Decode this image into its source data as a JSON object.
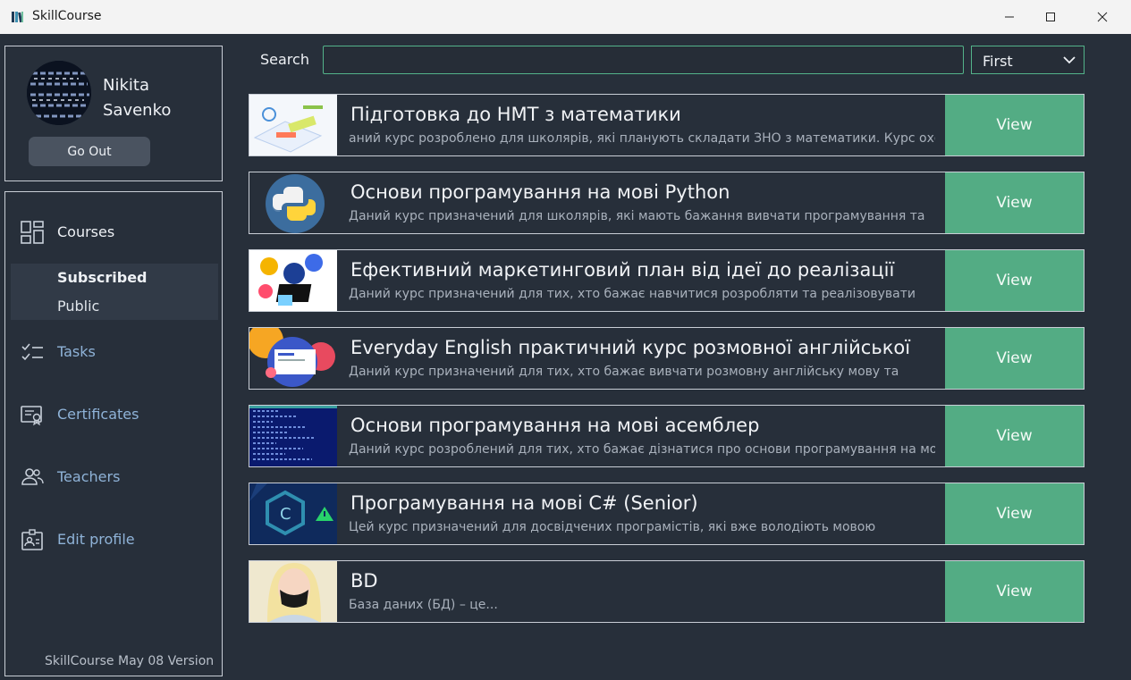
{
  "window": {
    "title": "SkillCourse"
  },
  "profile": {
    "name": "Nikita\nSavenko",
    "go_out_label": "Go Out"
  },
  "nav": {
    "courses": "Courses",
    "subscribed": "Subscribed",
    "public": "Public",
    "tasks": "Tasks",
    "certificates": "Certificates",
    "teachers": "Teachers",
    "edit_profile": "Edit profile"
  },
  "footer": {
    "version_text": "SkillCourse  May 08 Version"
  },
  "search": {
    "label": "Search",
    "value": "",
    "sort_selected": "First"
  },
  "courses": [
    {
      "title": "Підготовка до НМТ з математики",
      "desc": "аний курс розроблено для школярів, які планують складати ЗНО з математики. Курс охоплює",
      "button": "View"
    },
    {
      "title": "Основи програмування на мові Python",
      "desc": "Даний курс призначений для школярів, які мають бажання вивчати програмування та",
      "button": "View"
    },
    {
      "title": "Ефективний маркетинговий план від ідеї до реалізації",
      "desc": "Даний курс призначений для тих, хто бажає навчитися розробляти та реалізовувати",
      "button": "View"
    },
    {
      "title": "Everyday English практичний курс розмовної англійської",
      "desc": "Даний курс призначений для тих, хто бажає вивчати розмовну англійську мову та",
      "button": "View"
    },
    {
      "title": "Основи програмування на мові асемблер",
      "desc": "Даний курс розроблений для тих, хто бажає дізнатися про основи програмування на мові",
      "button": "View"
    },
    {
      "title": "Програмування на мові C# (Senior)",
      "desc": "Цей курс призначений для досвідчених програмістів, які вже володіють мовою",
      "button": "View"
    },
    {
      "title": "BD",
      "desc": "База даних (БД) – це...",
      "button": "View"
    }
  ],
  "colors": {
    "accent": "#53ac84",
    "background": "#272f3a",
    "link": "#8fb3d8"
  }
}
